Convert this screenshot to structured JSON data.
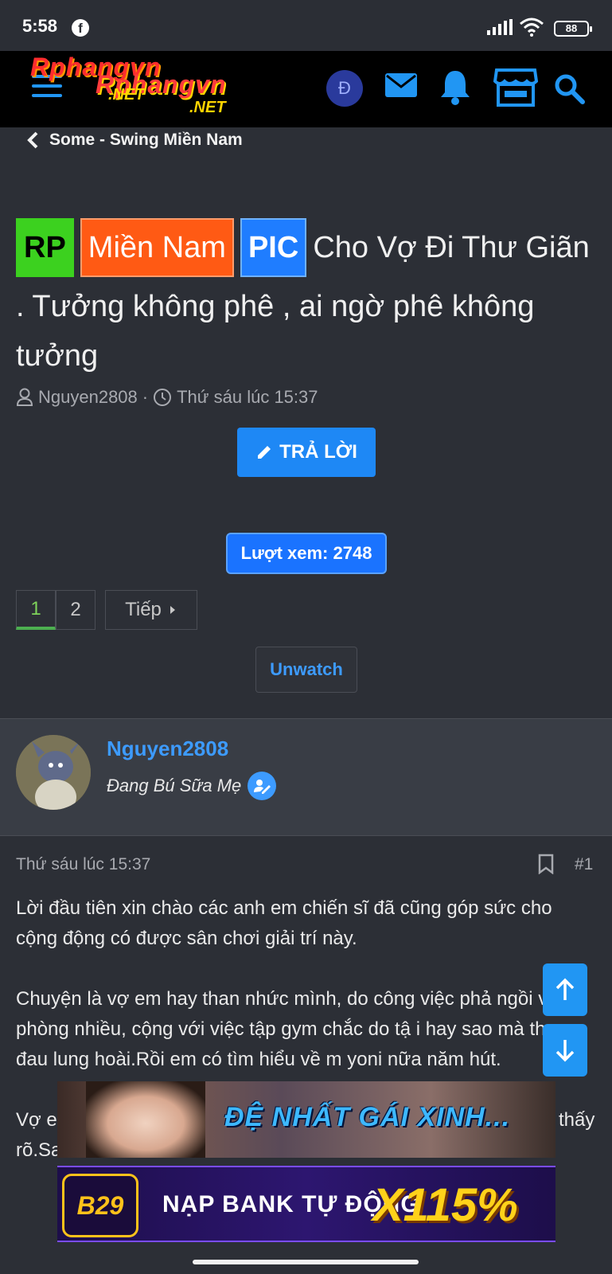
{
  "status_bar": {
    "time": "5:58",
    "battery": "88"
  },
  "header": {
    "logo_line1": "Rphangvn",
    "logo_line2": "Rphangvn",
    "logo_net1": ".NET",
    "logo_net2": ".NET",
    "coin_symbol": "Đ"
  },
  "breadcrumb": {
    "label": "Some - Swing Miền Nam"
  },
  "thread": {
    "tags": [
      {
        "label": "RP",
        "color": "#3cd11f"
      },
      {
        "label": "Miền Nam",
        "color": "#ff5a14"
      },
      {
        "label": "PIC",
        "color": "#1f7dff"
      }
    ],
    "title": "Cho Vợ Đi Thư Giãn . Tưởng không phê , ai ngờ phê không tưởng",
    "author": "Nguyen2808",
    "date": "Thứ sáu lúc 15:37",
    "reply_label": "TRẢ LỜI",
    "views_label": "Lượt xem: 2748",
    "pages": [
      "1",
      "2"
    ],
    "next_label": "Tiếp",
    "unwatch_label": "Unwatch"
  },
  "post": {
    "author": "Nguyen2808",
    "user_title": "Đang Bú Sữa Mẹ",
    "date": "Thứ sáu lúc 15:37",
    "number": "#1",
    "paragraphs": [
      "Lời đầu tiên xin chào các anh em chiến sĩ đã cũng góp sức cho cộng động có được sân chơi giải trí này.",
      "Chuyện là vợ em hay than nhức mình, do công việc phả ngồi văn phòng nhiều, cộng với việc tập gym chắc do tậ i hay sao mà than đau lung hoài.Rồi em có tìm hiểu về m yoni nữa năm hút.",
      "Vợ e rồi về cl ể ăn uống làm vui chơi, thì thấy tâm lý vợ tươi vui thấy rõ.Sau"
    ]
  },
  "ads": [
    {
      "text": "ĐỆ NHẤT GÁI XINH..."
    },
    {
      "brand": "B29",
      "text": "NẠP BANK TỰ ĐỘNG",
      "bonus": "X115%"
    }
  ],
  "colors": {
    "accent": "#2196f3",
    "background": "#2c2f36",
    "header": "#000000"
  }
}
